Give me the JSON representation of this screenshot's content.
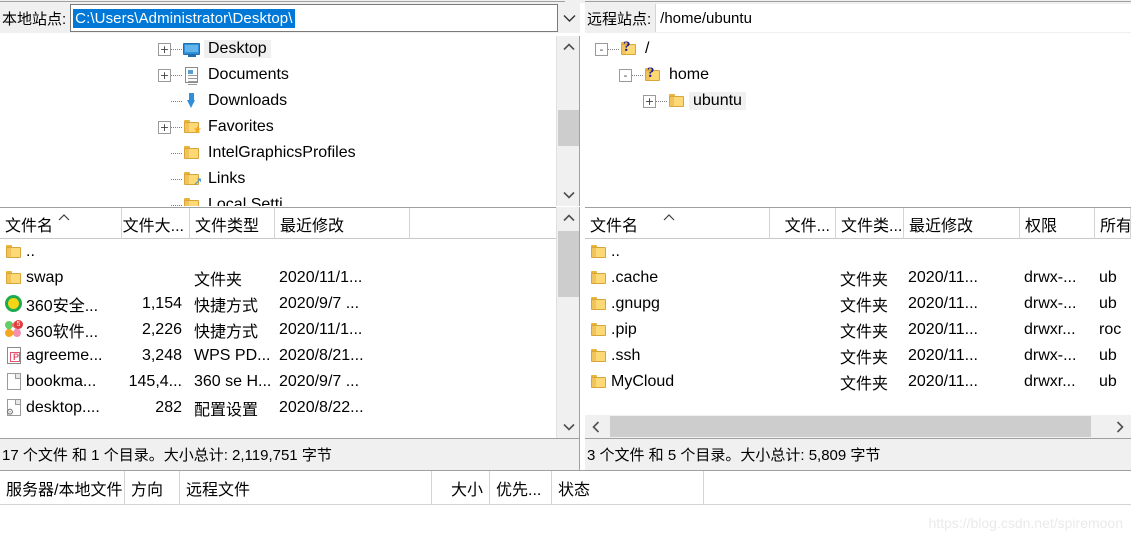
{
  "local": {
    "site_label": "本地站点:",
    "path_value": "C:\\Users\\Administrator\\Desktop\\",
    "dropdown_icon": "chevron-down-icon",
    "tree": [
      {
        "label": "Desktop",
        "icon": "monitor-icon",
        "expander": "+",
        "indent": 1,
        "selected": true
      },
      {
        "label": "Documents",
        "icon": "document-icon",
        "expander": "+",
        "indent": 1,
        "selected": false
      },
      {
        "label": "Downloads",
        "icon": "download-arrow-icon",
        "expander": "",
        "indent": 1,
        "selected": false
      },
      {
        "label": "Favorites",
        "icon": "folder-star-icon",
        "expander": "+",
        "indent": 1,
        "selected": false
      },
      {
        "label": "IntelGraphicsProfiles",
        "icon": "folder-icon",
        "expander": "",
        "indent": 1,
        "selected": false
      },
      {
        "label": "Links",
        "icon": "folder-arrow-icon",
        "expander": "",
        "indent": 1,
        "selected": false
      },
      {
        "label": "Local Setti",
        "icon": "folder-icon",
        "expander": "",
        "indent": 1,
        "selected": false
      }
    ],
    "columns": [
      {
        "key": "name",
        "label": "文件名",
        "align": "left",
        "sorted": true
      },
      {
        "key": "size",
        "label": "文件大...",
        "align": "right",
        "sorted": false
      },
      {
        "key": "type",
        "label": "文件类型",
        "align": "left",
        "sorted": false
      },
      {
        "key": "date",
        "label": "最近修改",
        "align": "left",
        "sorted": false
      }
    ],
    "rows": [
      {
        "icon": "folder-icon",
        "name": "..",
        "size": "",
        "type": "",
        "date": ""
      },
      {
        "icon": "folder-icon",
        "name": "swap",
        "size": "",
        "type": "文件夹",
        "date": "2020/11/1..."
      },
      {
        "icon": "360-safe-icon",
        "name": "360安全...",
        "size": "1,154",
        "type": "快捷方式",
        "date": "2020/9/7 ..."
      },
      {
        "icon": "360-software-icon",
        "name": "360软件...",
        "size": "2,226",
        "type": "快捷方式",
        "date": "2020/11/1..."
      },
      {
        "icon": "pdf-file-icon",
        "name": "agreeme...",
        "size": "3,248",
        "type": "WPS PD...",
        "date": "2020/8/21..."
      },
      {
        "icon": "generic-file-icon",
        "name": "bookma...",
        "size": "145,4...",
        "type": "360 se H...",
        "date": "2020/9/7 ..."
      },
      {
        "icon": "config-file-icon",
        "name": "desktop....",
        "size": "282",
        "type": "配置设置",
        "date": "2020/8/22..."
      }
    ],
    "status": "17 个文件 和 1 个目录。大小总计: 2,119,751 字节"
  },
  "remote": {
    "site_label": "远程站点:",
    "path_value": "/home/ubuntu",
    "tree": [
      {
        "label": "/",
        "icon": "folder-question-icon",
        "expander": "-",
        "indent": 0,
        "selected": false
      },
      {
        "label": "home",
        "icon": "folder-question-icon",
        "expander": "-",
        "indent": 1,
        "selected": false
      },
      {
        "label": "ubuntu",
        "icon": "folder-icon",
        "expander": "+",
        "indent": 2,
        "selected": true
      }
    ],
    "columns": [
      {
        "key": "name",
        "label": "文件名",
        "align": "left",
        "sorted": true
      },
      {
        "key": "size",
        "label": "文件...",
        "align": "right",
        "sorted": false
      },
      {
        "key": "type",
        "label": "文件类...",
        "align": "left",
        "sorted": false
      },
      {
        "key": "date",
        "label": "最近修改",
        "align": "left",
        "sorted": false
      },
      {
        "key": "perm",
        "label": "权限",
        "align": "left",
        "sorted": false
      },
      {
        "key": "owner",
        "label": "所有",
        "align": "left",
        "sorted": false
      }
    ],
    "rows": [
      {
        "icon": "folder-icon",
        "name": "..",
        "size": "",
        "type": "",
        "date": "",
        "perm": "",
        "owner": ""
      },
      {
        "icon": "folder-icon",
        "name": ".cache",
        "size": "",
        "type": "文件夹",
        "date": "2020/11...",
        "perm": "drwx-...",
        "owner": "ub"
      },
      {
        "icon": "folder-icon",
        "name": ".gnupg",
        "size": "",
        "type": "文件夹",
        "date": "2020/11...",
        "perm": "drwx-...",
        "owner": "ub"
      },
      {
        "icon": "folder-icon",
        "name": ".pip",
        "size": "",
        "type": "文件夹",
        "date": "2020/11...",
        "perm": "drwxr...",
        "owner": "roc"
      },
      {
        "icon": "folder-icon",
        "name": ".ssh",
        "size": "",
        "type": "文件夹",
        "date": "2020/11...",
        "perm": "drwx-...",
        "owner": "ub"
      },
      {
        "icon": "folder-icon",
        "name": "MyCloud",
        "size": "",
        "type": "文件夹",
        "date": "2020/11...",
        "perm": "drwxr...",
        "owner": "ub"
      }
    ],
    "status": "3 个文件 和 5 个目录。大小总计: 5,809 字节"
  },
  "queue": {
    "columns": [
      {
        "label": "服务器/本地文件",
        "align": "left"
      },
      {
        "label": "方向",
        "align": "left"
      },
      {
        "label": "远程文件",
        "align": "left"
      },
      {
        "label": "大小",
        "align": "right"
      },
      {
        "label": "优先...",
        "align": "left"
      },
      {
        "label": "状态",
        "align": "left"
      }
    ]
  },
  "watermark": "https://blog.csdn.net/spiremoon",
  "colors": {
    "selection_blue": "#0078d7",
    "panel_grey": "#f0f0f0",
    "border_grey": "#a0a0a0",
    "scroll_thumb": "#cdcdcd"
  }
}
